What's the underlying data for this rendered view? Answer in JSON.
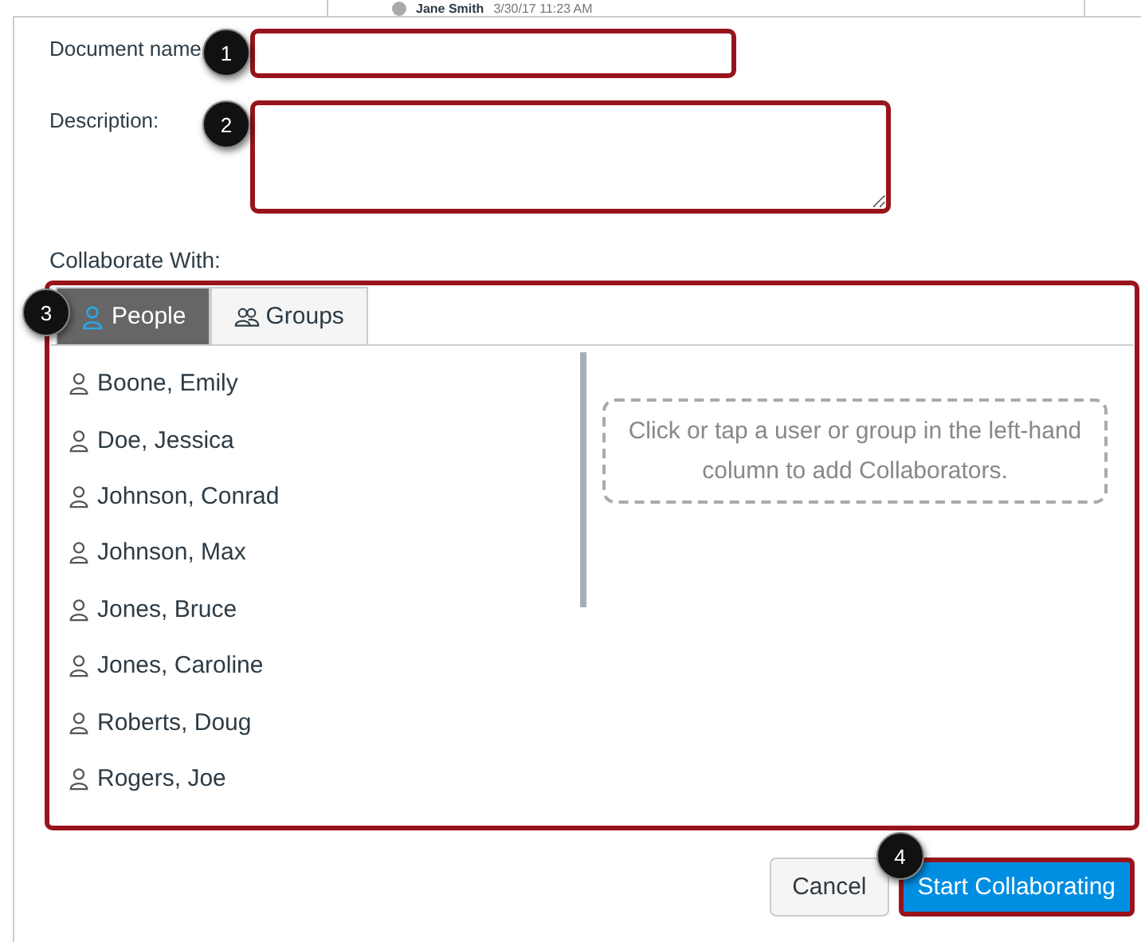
{
  "background": {
    "author": "Jane Smith",
    "timestamp": "3/30/17 11:23 AM"
  },
  "form": {
    "document_name": {
      "label": "Document name",
      "callout": "1"
    },
    "description": {
      "label": "Description:",
      "callout": "2"
    },
    "collaborate": {
      "label": "Collaborate With:",
      "callout": "3",
      "tabs": [
        {
          "label": "People",
          "selected": true
        },
        {
          "label": "Groups",
          "selected": false
        }
      ],
      "people": [
        "Boone, Emily",
        "Doe, Jessica",
        "Johnson, Conrad",
        "Johnson, Max",
        "Jones, Bruce",
        "Jones, Caroline",
        "Roberts, Doug",
        "Rogers, Joe"
      ],
      "hint": "Click or tap a user or group in the left-hand column to add Collaborators."
    }
  },
  "buttons": {
    "cancel": "Cancel",
    "submit": "Start Collaborating",
    "submit_callout": "4"
  }
}
